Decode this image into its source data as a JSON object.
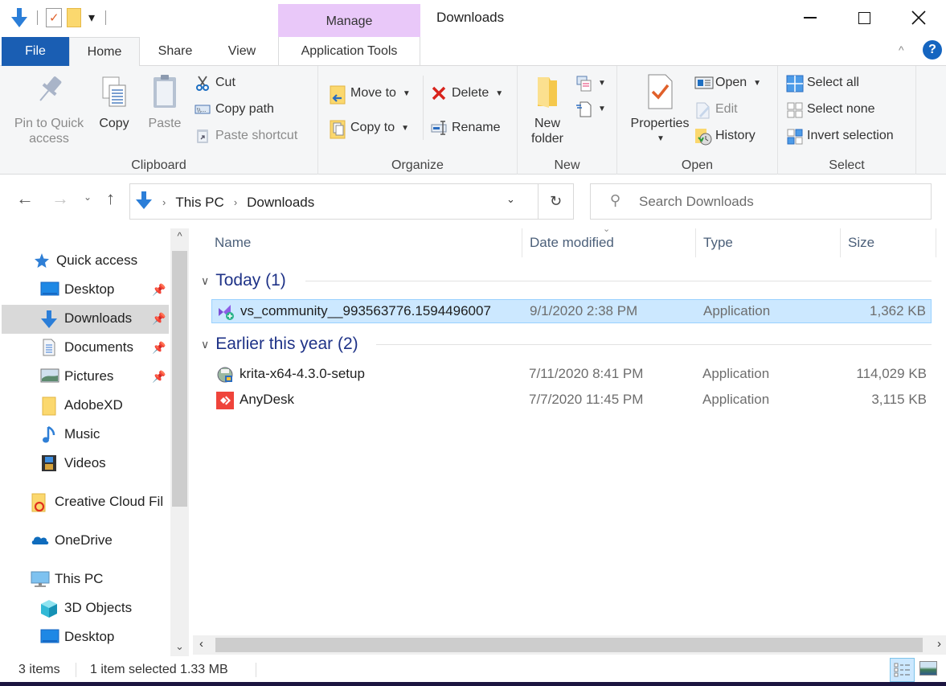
{
  "window": {
    "title": "Downloads",
    "context_tab_group": "Manage"
  },
  "ribbon_tabs": [
    {
      "label": "File"
    },
    {
      "label": "Home"
    },
    {
      "label": "Share"
    },
    {
      "label": "View"
    },
    {
      "label": "Application Tools"
    }
  ],
  "ribbon": {
    "clipboard": {
      "label": "Clipboard",
      "pin": "Pin to Quick access",
      "pin_line1": "Pin to Quick",
      "pin_line2": "access",
      "copy": "Copy",
      "paste": "Paste",
      "cut": "Cut",
      "copy_path": "Copy path",
      "paste_shortcut": "Paste shortcut"
    },
    "organize": {
      "label": "Organize",
      "move_to": "Move to",
      "copy_to": "Copy to",
      "delete": "Delete",
      "rename": "Rename"
    },
    "new": {
      "label": "New",
      "new_folder_line1": "New",
      "new_folder_line2": "folder"
    },
    "open": {
      "label": "Open",
      "properties": "Properties",
      "open": "Open",
      "edit": "Edit",
      "history": "History"
    },
    "select": {
      "label": "Select",
      "select_all": "Select all",
      "select_none": "Select none",
      "invert": "Invert selection"
    }
  },
  "address": {
    "breadcrumb": [
      "This PC",
      "Downloads"
    ],
    "search_placeholder": "Search Downloads"
  },
  "nav_pane": {
    "items": [
      {
        "label": "Quick access",
        "icon": "star-icon"
      },
      {
        "label": "Desktop",
        "icon": "desktop-icon",
        "pinned": true
      },
      {
        "label": "Downloads",
        "icon": "download-arrow-icon",
        "pinned": true,
        "selected": true
      },
      {
        "label": "Documents",
        "icon": "document-icon",
        "pinned": true
      },
      {
        "label": "Pictures",
        "icon": "pictures-icon",
        "pinned": true
      },
      {
        "label": "AdobeXD",
        "icon": "folder-icon"
      },
      {
        "label": "Music",
        "icon": "music-note-icon"
      },
      {
        "label": "Videos",
        "icon": "film-icon"
      },
      {
        "label": "Creative Cloud Fil",
        "icon": "creative-cloud-folder-icon"
      },
      {
        "label": "OneDrive",
        "icon": "cloud-icon"
      },
      {
        "label": "This PC",
        "icon": "computer-icon"
      },
      {
        "label": "3D Objects",
        "icon": "cube-icon"
      },
      {
        "label": "Desktop",
        "icon": "desktop-icon"
      }
    ]
  },
  "file_list": {
    "columns": [
      "Name",
      "Date modified",
      "Type",
      "Size"
    ],
    "groups": [
      {
        "title": "Today (1)",
        "rows": [
          {
            "name": "vs_community__993563776.1594496007",
            "date": "9/1/2020 2:38 PM",
            "type": "Application",
            "size": "1,362 KB",
            "selected": true,
            "icon": "visual-studio-installer-icon"
          }
        ]
      },
      {
        "title": "Earlier this year (2)",
        "rows": [
          {
            "name": "krita-x64-4.3.0-setup",
            "date": "7/11/2020 8:41 PM",
            "type": "Application",
            "size": "114,029 KB",
            "icon": "setup-installer-icon"
          },
          {
            "name": "AnyDesk",
            "date": "7/7/2020 11:45 PM",
            "type": "Application",
            "size": "3,115 KB",
            "icon": "anydesk-icon"
          }
        ]
      }
    ]
  },
  "status": {
    "item_count": "3 items",
    "selection": "1 item selected  1.33 MB"
  },
  "colors": {
    "accent": "#1a5eb3",
    "manage_tab": "#e9c8f9",
    "selection": "#cce8ff",
    "group_header": "#1e3287"
  }
}
